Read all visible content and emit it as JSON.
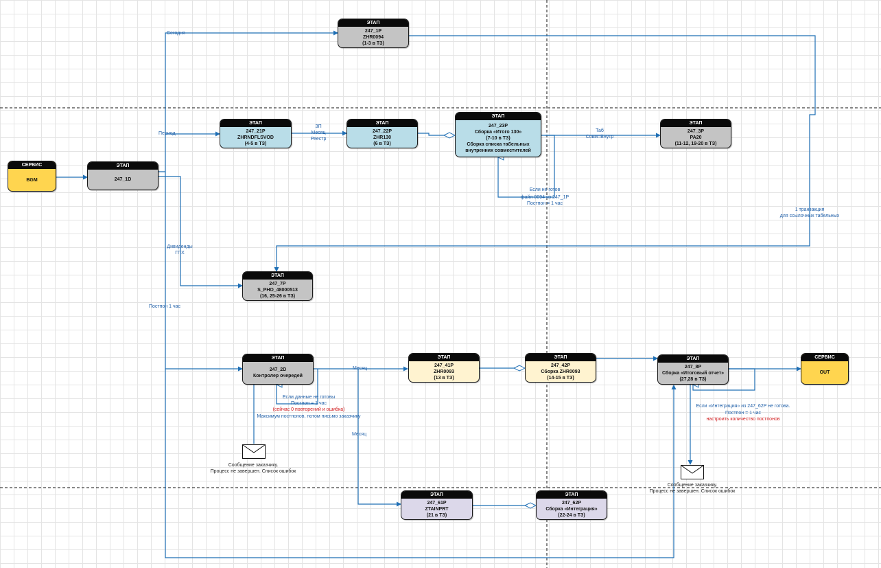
{
  "colors": {
    "blue_node": "#b9dde8",
    "gray_node": "#c4c4c4",
    "yellow_service": "#ffd54f",
    "cream_node": "#fff3d0",
    "lavender_node": "#dcd8ea",
    "connector": "#1f6fb5",
    "label_blue": "#1f5fa8",
    "label_red": "#d0181a"
  },
  "nodes": {
    "svc_bgm": {
      "header": "СЕРВИС",
      "lines": [
        "BGM"
      ]
    },
    "s247_1d": {
      "header": "ЭТАП",
      "lines": [
        "247_1D"
      ]
    },
    "s247_1p": {
      "header": "ЭТАП",
      "lines": [
        "247_1P",
        "ZHR0094",
        "(1-3 в ТЗ)"
      ]
    },
    "s247_21p": {
      "header": "ЭТАП",
      "lines": [
        "247_21P",
        "ZHRNDFLSVOD",
        "(4-5 в ТЗ)"
      ]
    },
    "s247_22p": {
      "header": "ЭТАП",
      "lines": [
        "247_22P",
        "ZHR130",
        "(6 в ТЗ)"
      ]
    },
    "s247_23p": {
      "header": "ЭТАП",
      "lines": [
        "247_23P",
        "Сборка «Итого 130»",
        "(7-10 в ТЗ)",
        "Сборка списка табельных",
        "внутренних совместителей"
      ]
    },
    "s247_3p": {
      "header": "ЭТАП",
      "lines": [
        "247_3P",
        "PA20",
        "(11-12,  19-20  в ТЗ)"
      ]
    },
    "s247_7p": {
      "header": "ЭТАП",
      "lines": [
        "247_7P",
        "S_PHO_48000513",
        "(16,  25-26  в  ТЗ)"
      ]
    },
    "s247_2d": {
      "header": "ЭТАП",
      "lines": [
        "247_2D",
        "Контролер очередей"
      ]
    },
    "s247_41p": {
      "header": "ЭТАП",
      "lines": [
        "247_41P",
        "ZHR0093",
        "(13  в  ТЗ)"
      ]
    },
    "s247_42p": {
      "header": "ЭТАП",
      "lines": [
        "247_42P",
        "Сборка ZHR0093",
        "(14-15  в  ТЗ)"
      ]
    },
    "s247_8p": {
      "header": "ЭТАП",
      "lines": [
        "247_8P",
        "Сборка «Итоговый отчет»",
        "(27,28  в  ТЗ)"
      ]
    },
    "svc_out": {
      "header": "СЕРВИС",
      "lines": [
        "OUT"
      ]
    },
    "s247_61p": {
      "header": "ЭТАП",
      "lines": [
        "247_61P",
        "ZTAINPRT",
        "(21  в  ТЗ)"
      ]
    },
    "s247_62p": {
      "header": "ЭТАП",
      "lines": [
        "247_62P",
        "Сборка «Интеграция»",
        "(22-24  в  ТЗ)"
      ]
    }
  },
  "labels": {
    "segodnya": "Сегодня",
    "period": "Период",
    "zp": "ЗП",
    "mesyac1": "Месяц",
    "reestr": "Реестр",
    "tab": "Таб",
    "sovm": "Совм=Внутр",
    "if_not_ready1": "Если не готов",
    "file_0094": "файл 0094 из 247_1P",
    "poston_1h_1": "Постпон = 1 час",
    "trans1": "1 транзакция",
    "trans2": "для ссылочных табельных",
    "dividends": "Дивиденды",
    "gph": "ГПХ",
    "poston_1h_main": "Постпон 1 час",
    "mesyac2": "Месяц",
    "mesyac3": "Месяц",
    "data_not_ready": "Если данные не готовы",
    "poston_1h_2": "Постпон = 1 час",
    "now_zero": "(сейчас 0 повторений и ошибка)",
    "max_poston": "Максимум постпонов, потом письмо заказчику",
    "msg1_l1": "Сообщение заказчику.",
    "msg1_l2": "Процесс не завершен. Список ошибок",
    "integ_not_ready": "Если «Интеграция» из 247_62P не готова.",
    "poston_1h_3": "Постпон = 1 час",
    "set_count": "настроить количество постпонов",
    "msg2_l1": "Сообщение заказчику.",
    "msg2_l2": "Процесс не завершен. Список ошибок"
  }
}
